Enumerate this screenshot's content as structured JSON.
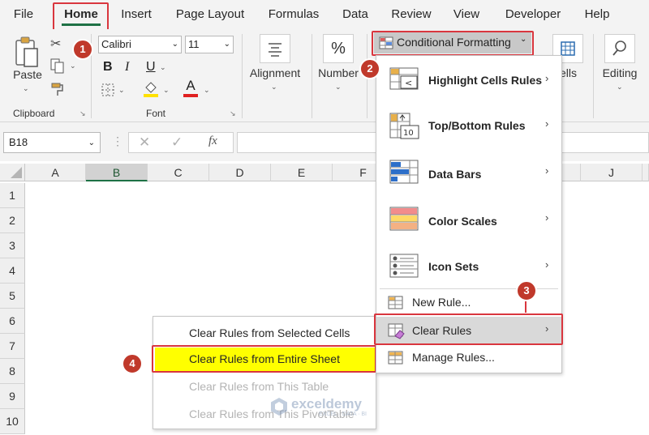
{
  "menu_tabs": [
    "File",
    "Home",
    "Insert",
    "Page Layout",
    "Formulas",
    "Data",
    "Review",
    "View",
    "Developer",
    "Help"
  ],
  "ribbon": {
    "paste_label": "Paste",
    "clipboard_label": "Clipboard",
    "font_name": "Calibri",
    "font_size": "11",
    "font_group_label": "Font",
    "alignment_label": "Alignment",
    "number_label": "Number",
    "conditional_formatting_label": "Conditional Formatting",
    "cells_label": "ells",
    "editing_label": "Editing",
    "bold_glyph": "B",
    "italic_glyph": "I",
    "underline_glyph": "U",
    "font_color_glyph": "A",
    "percent_glyph": "%",
    "font_color_bar": "#e02020",
    "highlight_color_bar": "#ffe100"
  },
  "formula_bar": {
    "name_box": "B18",
    "fx_label": "fx",
    "value": ""
  },
  "grid": {
    "columns": [
      "A",
      "B",
      "C",
      "D",
      "E",
      "F",
      "J"
    ],
    "rows": [
      "1",
      "2",
      "3",
      "4",
      "5",
      "6",
      "7",
      "8",
      "9",
      "10"
    ],
    "selected_column": "B"
  },
  "cf_menu": {
    "items": [
      {
        "label": "Highlight Cells Rules",
        "bold": true
      },
      {
        "label": "Top/Bottom Rules",
        "bold": true
      },
      {
        "label": "Data Bars",
        "bold": true
      },
      {
        "label": "Color Scales",
        "bold": true
      },
      {
        "label": "Icon Sets",
        "bold": true
      },
      {
        "label": "New Rule...",
        "bold": false
      },
      {
        "label": "Clear Rules",
        "bold": false
      },
      {
        "label": "Manage Rules...",
        "bold": false
      }
    ],
    "topbottom_icon_text": "10"
  },
  "clear_menu": {
    "items": [
      {
        "label": "Clear Rules from Selected Cells",
        "state": "normal"
      },
      {
        "label": "Clear Rules from Entire Sheet",
        "state": "highlighted"
      },
      {
        "label": "Clear Rules from This Table",
        "state": "disabled"
      },
      {
        "label": "Clear Rules from This PivotTable",
        "state": "disabled"
      }
    ]
  },
  "steps": [
    "1",
    "2",
    "3",
    "4"
  ],
  "watermark": "exceldemy",
  "watermark_sub": "EXCEL · DATA · BI",
  "colors": {
    "accent_green": "#1e7145",
    "annotation_red": "#d9363e",
    "highlight_yellow": "#ffff00",
    "hover_gray": "#d9d9d9"
  }
}
